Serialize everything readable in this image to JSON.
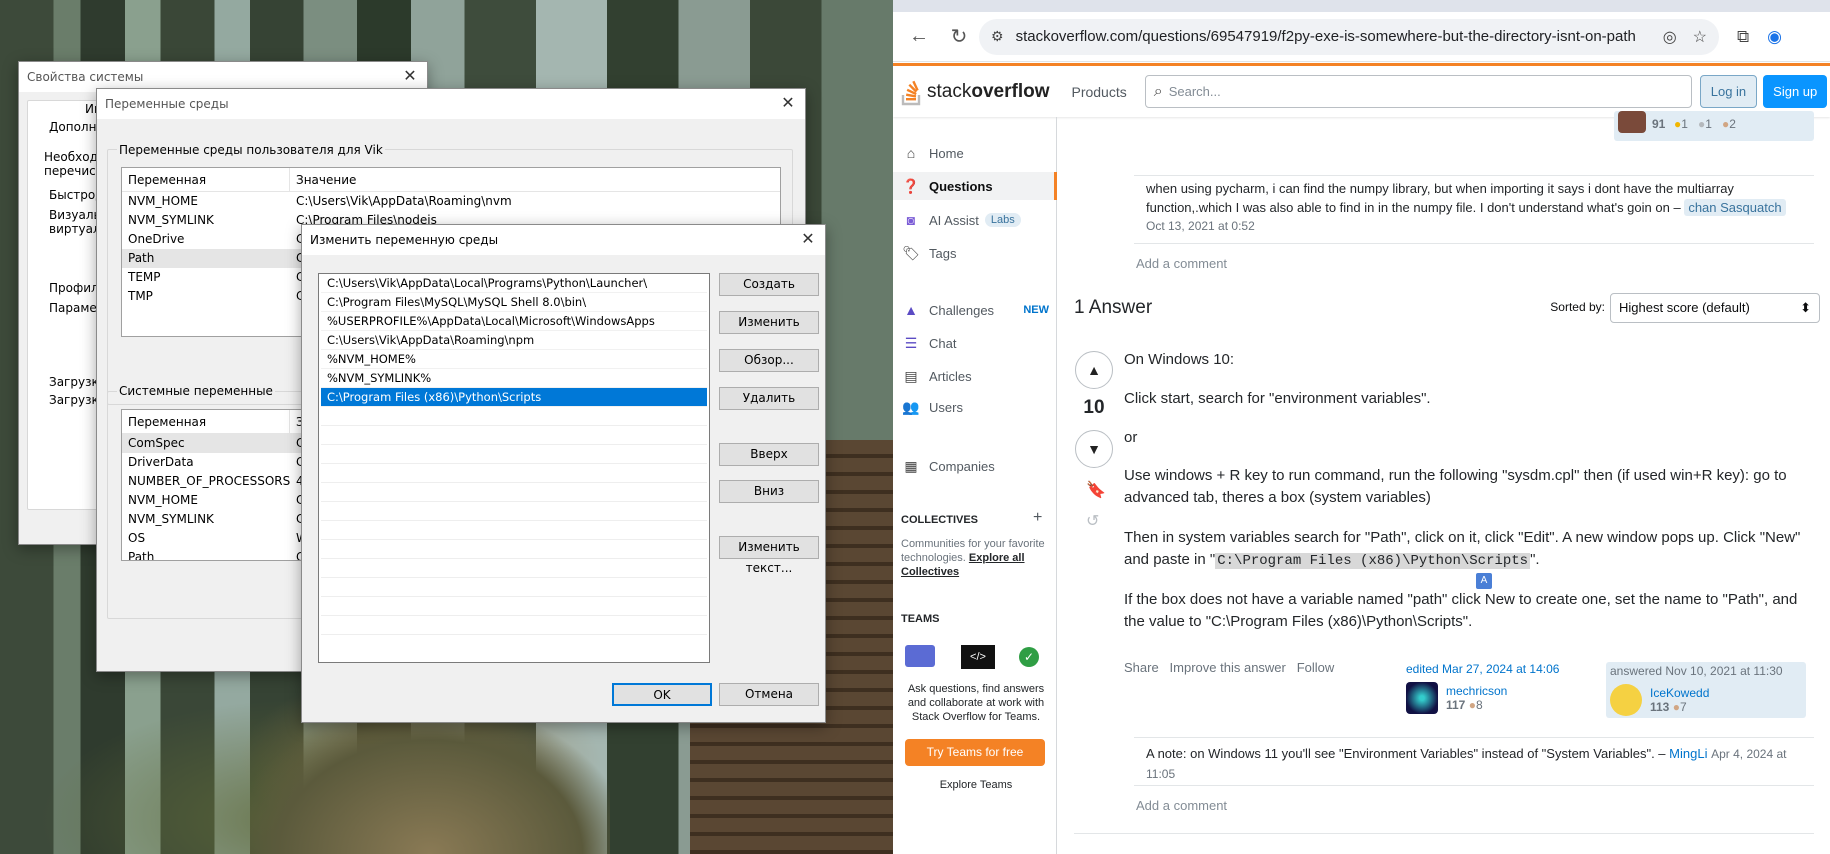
{
  "sysprops": {
    "title": "Свойства системы",
    "tab_fragment": "Ин",
    "lines": [
      "Дополни",
      "Необходим",
      "перечисле",
      "Быстродс",
      "Визуальн",
      "виртуаль",
      "Профили",
      "Парамет",
      "Загрузка",
      "Загрузка"
    ]
  },
  "envvars": {
    "title": "Переменные среды",
    "user_group": "Переменные среды пользователя для Vik",
    "col_var": "Переменная",
    "col_val": "Значение",
    "user_rows": [
      {
        "name": "NVM_HOME",
        "value": "C:\\Users\\Vik\\AppData\\Roaming\\nvm"
      },
      {
        "name": "NVM_SYMLINK",
        "value": "C:\\Program Files\\nodejs"
      },
      {
        "name": "OneDrive",
        "value": "C"
      },
      {
        "name": "Path",
        "value": "C"
      },
      {
        "name": "TEMP",
        "value": "C"
      },
      {
        "name": "TMP",
        "value": "C"
      }
    ],
    "sys_group": "Системные переменные",
    "sys_col_val": "З",
    "sys_rows": [
      {
        "name": "ComSpec",
        "value": "C"
      },
      {
        "name": "DriverData",
        "value": "C"
      },
      {
        "name": "NUMBER_OF_PROCESSORS",
        "value": "4"
      },
      {
        "name": "NVM_HOME",
        "value": "C"
      },
      {
        "name": "NVM_SYMLINK",
        "value": "C"
      },
      {
        "name": "OS",
        "value": "W"
      },
      {
        "name": "Path",
        "value": "C"
      }
    ]
  },
  "editdlg": {
    "title": "Изменить переменную среды",
    "items": [
      "C:\\Users\\Vik\\AppData\\Local\\Programs\\Python\\Launcher\\",
      "C:\\Program Files\\MySQL\\MySQL Shell 8.0\\bin\\",
      "%USERPROFILE%\\AppData\\Local\\Microsoft\\WindowsApps",
      "C:\\Users\\Vik\\AppData\\Roaming\\npm",
      "%NVM_HOME%",
      "%NVM_SYMLINK%",
      "C:\\Program Files (x86)\\Python\\Scripts"
    ],
    "btn_new": "Создать",
    "btn_edit": "Изменить",
    "btn_browse": "Обзор...",
    "btn_delete": "Удалить",
    "btn_up": "Вверх",
    "btn_down": "Вниз",
    "btn_edittext": "Изменить текст...",
    "btn_ok": "OK",
    "btn_cancel": "Отмена"
  },
  "browser": {
    "url": "stackoverflow.com/questions/69547919/f2py-exe-is-somewhere-but-the-directory-isnt-on-path"
  },
  "so": {
    "logo_a": "stack",
    "logo_b": "overflow",
    "products": "Products",
    "search_placeholder": "Search...",
    "login": "Log in",
    "signup": "Sign up",
    "nav": {
      "home": "Home",
      "questions": "Questions",
      "ai_assist": "AI Assist",
      "labs": "Labs",
      "tags": "Tags",
      "challenges": "Challenges",
      "new": "NEW",
      "chat": "Chat",
      "articles": "Articles",
      "users": "Users",
      "companies": "Companies"
    },
    "collectives_heading": "COLLECTIVES",
    "collectives_text": "Communities for your favorite technologies.",
    "collectives_link": "Explore all Collectives",
    "teams_heading": "TEAMS",
    "teams_text": "Ask questions, find answers and collaborate at work with Stack Overflow for Teams.",
    "teams_btn": "Try Teams for free",
    "teams_link": "Explore Teams",
    "top_user_rep": "91",
    "top_user_badges": [
      "1",
      "1",
      "2"
    ],
    "comment1": {
      "text": "when using pycharm, i can find the numpy library, but when importing it says i dont have the multiarray function,.which I was also able to find in in the numpy file. I don't understand what's goin on –",
      "user": "chan Sasquatch",
      "time": "Oct 13, 2021 at 0:52"
    },
    "add_comment": "Add a comment",
    "answers_count": "1 Answer",
    "sorted_by": "Sorted by:",
    "sort_value": "Highest score (default)",
    "score": "10",
    "answer": {
      "p1": "On Windows 10:",
      "p2": "Click start, search for \"environment variables\".",
      "p3": "or",
      "p4": "Use windows + R key to run command, run the following \"sysdm.cpl\" then (if used win+R key): go to advanced tab, theres a box (system variables)",
      "p5a": "Then in system variables search for \"Path\", click on it, click \"Edit\". A new window pops up. Click \"New\" and paste in \"",
      "p5code": "C:\\Program Files (x86)\\Python\\Scripts",
      "p5b": "\".",
      "p6": "If the box does not have a variable named \"path\" click New to create one, set the name to \"Path\", and the value to \"C:\\Program Files (x86)\\Python\\Scripts\"."
    },
    "share": "Share",
    "improve": "Improve this answer",
    "follow": "Follow",
    "edited": "edited Mar 27, 2024 at 14:06",
    "editor": "mechricson",
    "editor_rep": "117",
    "editor_badge": "8",
    "answered": "answered Nov 10, 2021 at 11:30",
    "author": "IceKowedd",
    "author_rep": "113",
    "author_badge": "7",
    "comment2": {
      "text": "A note: on Windows 11 you'll see \"Environment Variables\" instead of \"System Variables\". –",
      "user": "MingLi",
      "time": "Apr 4, 2024 at 11:05"
    }
  }
}
